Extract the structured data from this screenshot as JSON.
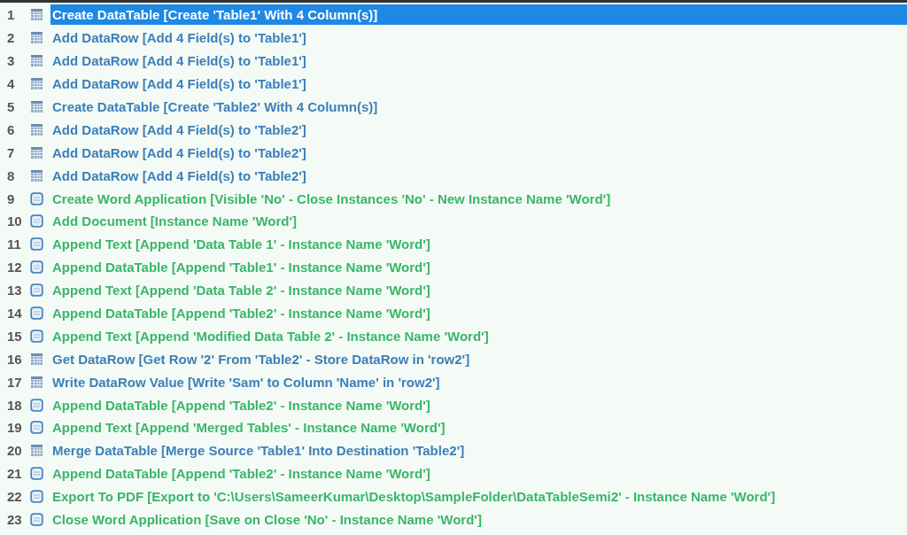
{
  "steps": [
    {
      "number": "1",
      "kind": "datatable",
      "selected": true,
      "text": "Create DataTable [Create 'Table1' With 4 Column(s)]"
    },
    {
      "number": "2",
      "kind": "datatable",
      "selected": false,
      "text": "Add DataRow [Add 4 Field(s) to 'Table1']"
    },
    {
      "number": "3",
      "kind": "datatable",
      "selected": false,
      "text": "Add DataRow [Add 4 Field(s) to 'Table1']"
    },
    {
      "number": "4",
      "kind": "datatable",
      "selected": false,
      "text": "Add DataRow [Add 4 Field(s) to 'Table1']"
    },
    {
      "number": "5",
      "kind": "datatable",
      "selected": false,
      "text": "Create DataTable [Create 'Table2' With 4 Column(s)]"
    },
    {
      "number": "6",
      "kind": "datatable",
      "selected": false,
      "text": "Add DataRow [Add 4 Field(s) to 'Table2']"
    },
    {
      "number": "7",
      "kind": "datatable",
      "selected": false,
      "text": "Add DataRow [Add 4 Field(s) to 'Table2']"
    },
    {
      "number": "8",
      "kind": "datatable",
      "selected": false,
      "text": "Add DataRow [Add 4 Field(s) to 'Table2']"
    },
    {
      "number": "9",
      "kind": "word",
      "selected": false,
      "text": "Create Word Application [Visible 'No' - Close Instances 'No' - New Instance Name 'Word']"
    },
    {
      "number": "10",
      "kind": "word",
      "selected": false,
      "text": "Add Document [Instance Name 'Word']"
    },
    {
      "number": "11",
      "kind": "word",
      "selected": false,
      "text": "Append Text [Append 'Data Table 1' - Instance Name 'Word']"
    },
    {
      "number": "12",
      "kind": "word",
      "selected": false,
      "text": "Append DataTable [Append 'Table1' - Instance Name 'Word']"
    },
    {
      "number": "13",
      "kind": "word",
      "selected": false,
      "text": "Append Text [Append 'Data Table 2' - Instance Name 'Word']"
    },
    {
      "number": "14",
      "kind": "word",
      "selected": false,
      "text": "Append DataTable [Append 'Table2' - Instance Name 'Word']"
    },
    {
      "number": "15",
      "kind": "word",
      "selected": false,
      "text": "Append Text [Append 'Modified Data Table 2' - Instance Name 'Word']"
    },
    {
      "number": "16",
      "kind": "datatable",
      "selected": false,
      "text": "Get DataRow [Get Row '2' From 'Table2' - Store DataRow in 'row2']"
    },
    {
      "number": "17",
      "kind": "datatable",
      "selected": false,
      "text": "Write DataRow Value [Write 'Sam' to Column 'Name' in 'row2']"
    },
    {
      "number": "18",
      "kind": "word",
      "selected": false,
      "text": "Append DataTable [Append 'Table2' - Instance Name 'Word']"
    },
    {
      "number": "19",
      "kind": "word",
      "selected": false,
      "text": "Append Text [Append 'Merged Tables' - Instance Name 'Word']"
    },
    {
      "number": "20",
      "kind": "datatable",
      "selected": false,
      "text": "Merge DataTable [Merge Source 'Table1' Into Destination 'Table2']"
    },
    {
      "number": "21",
      "kind": "word",
      "selected": false,
      "text": "Append DataTable [Append 'Table2' - Instance Name 'Word']"
    },
    {
      "number": "22",
      "kind": "word",
      "selected": false,
      "text": "Export To PDF [Export to 'C:\\Users\\SameerKumar\\Desktop\\SampleFolder\\DataTableSemi2' - Instance Name 'Word']"
    },
    {
      "number": "23",
      "kind": "word",
      "selected": false,
      "text": "Close Word Application [Save on Close 'No' - Instance Name 'Word']"
    }
  ]
}
